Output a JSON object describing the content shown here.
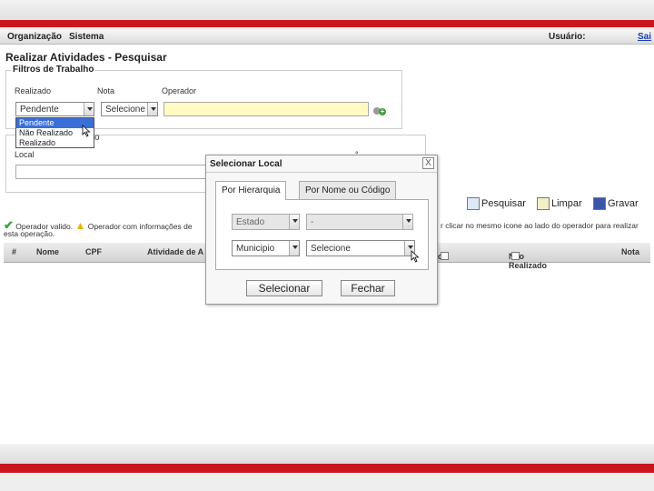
{
  "menu": {
    "item1": "Organização",
    "item2": "Sistema",
    "user_label": "Usuário:",
    "logout": "Sai"
  },
  "page": {
    "title": "Realizar Atividades - Pesquisar",
    "filters_legend": "Filtros de Trabalho"
  },
  "filters": {
    "realizado_label": "Realizado",
    "nota_label": "Nota",
    "operador_label": "Operador",
    "realizado_value": "Pendente",
    "nota_value": "Selecione",
    "options": [
      "Pendente",
      "Não Realizado",
      "Realizado"
    ],
    "local_label": "Local",
    "partial_label": "o"
  },
  "toolbar": {
    "search": "Pesquisar",
    "clear": "Limpar",
    "save": "Gravar"
  },
  "legend": {
    "valid": "Operador valido.",
    "warning": "Operador com informações de",
    "right_text": "r clicar no mesmo icone ao lado do operador para realizar",
    "line2": "esta operação."
  },
  "grid": {
    "headers": [
      "#",
      "Nome",
      "CPF",
      "Atividade de A",
      "o",
      "Não Realizado",
      "Nota"
    ]
  },
  "modal": {
    "title": "Selecionar Local",
    "close": "X",
    "tab1": "Por Hierarquia",
    "tab2": "Por Nome ou Código",
    "estado_label": "Estado",
    "estado_value": "-",
    "municipio_label": "Municipio",
    "municipio_value": "Selecione",
    "btn_select": "Selecionar",
    "btn_close": "Fechar"
  },
  "colors": {
    "brand_red": "#c8161d",
    "input_yellow": "#fffbc2",
    "select_blue": "#3a6fd8"
  }
}
